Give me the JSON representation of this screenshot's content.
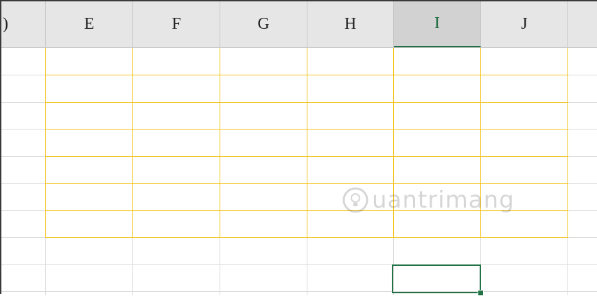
{
  "columns": [
    {
      "label": ")",
      "partial": true,
      "selected": false
    },
    {
      "label": "E",
      "selected": false
    },
    {
      "label": "F",
      "selected": false
    },
    {
      "label": "G",
      "selected": false
    },
    {
      "label": "H",
      "selected": false
    },
    {
      "label": "I",
      "selected": true
    },
    {
      "label": "J",
      "selected": false
    },
    {
      "label": "",
      "selected": false
    }
  ],
  "active_cell_column": "I",
  "border_color": "#f2c218",
  "selection_color": "#217346",
  "watermark": {
    "text": "uantrimang",
    "icon": "lightbulb-logo-icon"
  }
}
